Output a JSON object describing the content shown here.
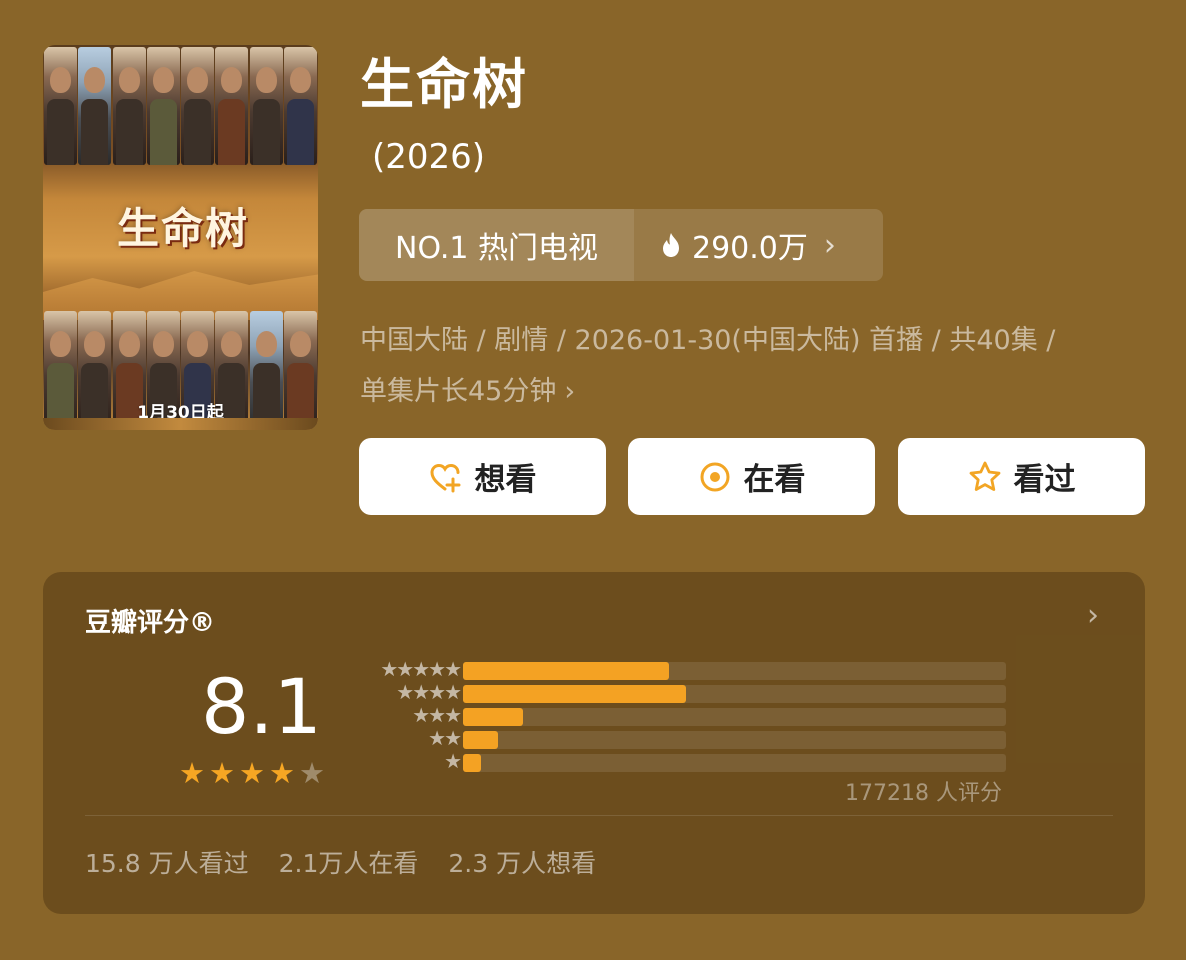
{
  "poster": {
    "logo_text": "生命树",
    "date_text": "1月30日起"
  },
  "title": "生命树",
  "year": "(2026)",
  "rank": {
    "label": "NO.1 热门电视",
    "heat": "290.0万",
    "chevron": "›"
  },
  "meta": {
    "line1": "中国大陆 / 剧情 / 2026-01-30(中国大陆) 首播 / 共40集 /",
    "line2": "单集片长45分钟",
    "chevron": "›"
  },
  "actions": {
    "want_label": "想看",
    "watching_label": "在看",
    "watched_label": "看过"
  },
  "rating": {
    "title": "豆瓣评分®",
    "chevron": "›",
    "score": "8.1",
    "stars_filled": 4,
    "stars_total": 5,
    "breakdown": [
      {
        "stars": "★★★★★",
        "fraction": 0.38
      },
      {
        "stars": "★★★★",
        "fraction": 0.41
      },
      {
        "stars": "★★★",
        "fraction": 0.11
      },
      {
        "stars": "★★",
        "fraction": 0.065
      },
      {
        "stars": "★",
        "fraction": 0.033
      }
    ],
    "count_text": "177218 人评分",
    "stats": {
      "watched": "15.8 万人看过",
      "watching": "2.1万人在看",
      "want": "2.3 万人想看"
    }
  },
  "colors": {
    "background": "#896529",
    "accent": "#f4a223",
    "button_bg": "#ffffff"
  }
}
